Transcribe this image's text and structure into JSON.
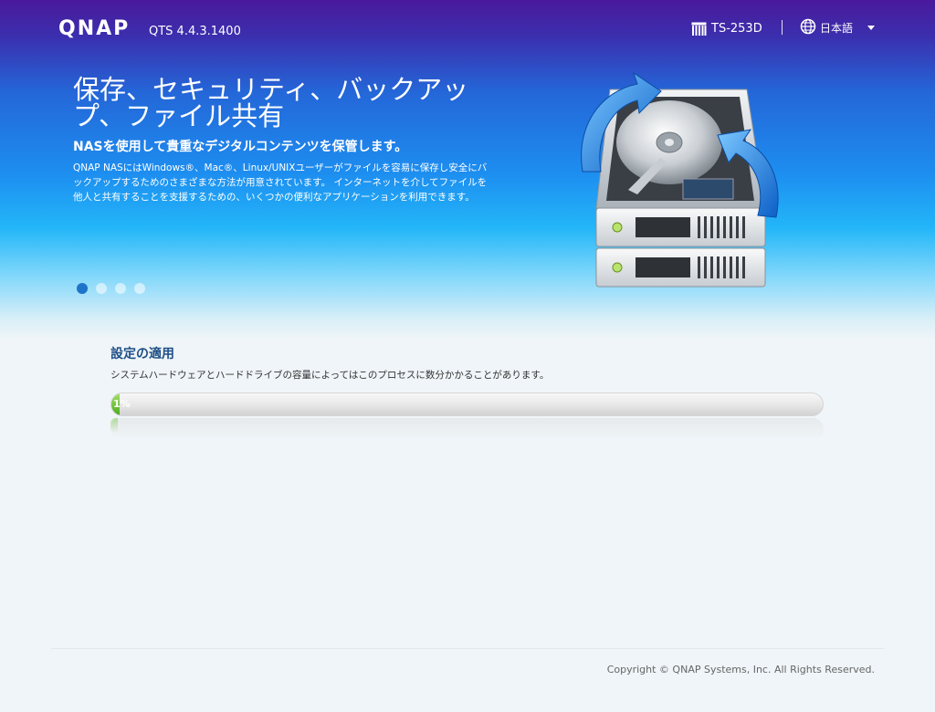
{
  "header": {
    "logo": "QNAP",
    "version": "QTS 4.4.3.1400",
    "device_name": "TS-253D",
    "language": "日本語"
  },
  "slide": {
    "title": "保存、セキュリティ、バックアップ、ファイル共有",
    "subtitle": "NASを使用して貴重なデジタルコンテンツを保管します。",
    "body": "QNAP NASにはWindows®、Mac®、Linux/UNIXユーザーがファイルを容易に保存し安全にバックアップするためのさまざまな方法が用意されています。 インターネットを介してファイルを他人と共有することを支援するための、いくつかの便利なアプリケーションを利用できます。",
    "active_index": 0,
    "count": 4
  },
  "apply": {
    "title": "設定の適用",
    "description": "システムハードウェアとハードドライブの容量によってはこのプロセスに数分かかることがあります。",
    "progress_percent": 1,
    "progress_label": "1%"
  },
  "footer": {
    "copyright": "Copyright © QNAP Systems, Inc. All Rights Reserved."
  },
  "colors": {
    "accent": "#1d74c9",
    "progress": "#6cc237",
    "heading": "#1f4f86"
  },
  "icons": [
    "device-icon",
    "globe-icon",
    "chevron-down-icon",
    "hard-drive-illustration"
  ]
}
